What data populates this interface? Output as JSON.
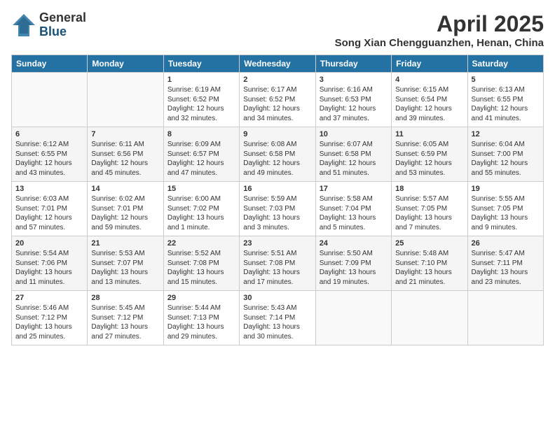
{
  "logo": {
    "general": "General",
    "blue": "Blue"
  },
  "title": {
    "month_year": "April 2025",
    "location": "Song Xian Chengguanzhen, Henan, China"
  },
  "headers": [
    "Sunday",
    "Monday",
    "Tuesday",
    "Wednesday",
    "Thursday",
    "Friday",
    "Saturday"
  ],
  "weeks": [
    [
      {
        "day": "",
        "info": ""
      },
      {
        "day": "",
        "info": ""
      },
      {
        "day": "1",
        "info": "Sunrise: 6:19 AM\nSunset: 6:52 PM\nDaylight: 12 hours\nand 32 minutes."
      },
      {
        "day": "2",
        "info": "Sunrise: 6:17 AM\nSunset: 6:52 PM\nDaylight: 12 hours\nand 34 minutes."
      },
      {
        "day": "3",
        "info": "Sunrise: 6:16 AM\nSunset: 6:53 PM\nDaylight: 12 hours\nand 37 minutes."
      },
      {
        "day": "4",
        "info": "Sunrise: 6:15 AM\nSunset: 6:54 PM\nDaylight: 12 hours\nand 39 minutes."
      },
      {
        "day": "5",
        "info": "Sunrise: 6:13 AM\nSunset: 6:55 PM\nDaylight: 12 hours\nand 41 minutes."
      }
    ],
    [
      {
        "day": "6",
        "info": "Sunrise: 6:12 AM\nSunset: 6:55 PM\nDaylight: 12 hours\nand 43 minutes."
      },
      {
        "day": "7",
        "info": "Sunrise: 6:11 AM\nSunset: 6:56 PM\nDaylight: 12 hours\nand 45 minutes."
      },
      {
        "day": "8",
        "info": "Sunrise: 6:09 AM\nSunset: 6:57 PM\nDaylight: 12 hours\nand 47 minutes."
      },
      {
        "day": "9",
        "info": "Sunrise: 6:08 AM\nSunset: 6:58 PM\nDaylight: 12 hours\nand 49 minutes."
      },
      {
        "day": "10",
        "info": "Sunrise: 6:07 AM\nSunset: 6:58 PM\nDaylight: 12 hours\nand 51 minutes."
      },
      {
        "day": "11",
        "info": "Sunrise: 6:05 AM\nSunset: 6:59 PM\nDaylight: 12 hours\nand 53 minutes."
      },
      {
        "day": "12",
        "info": "Sunrise: 6:04 AM\nSunset: 7:00 PM\nDaylight: 12 hours\nand 55 minutes."
      }
    ],
    [
      {
        "day": "13",
        "info": "Sunrise: 6:03 AM\nSunset: 7:01 PM\nDaylight: 12 hours\nand 57 minutes."
      },
      {
        "day": "14",
        "info": "Sunrise: 6:02 AM\nSunset: 7:01 PM\nDaylight: 12 hours\nand 59 minutes."
      },
      {
        "day": "15",
        "info": "Sunrise: 6:00 AM\nSunset: 7:02 PM\nDaylight: 13 hours\nand 1 minute."
      },
      {
        "day": "16",
        "info": "Sunrise: 5:59 AM\nSunset: 7:03 PM\nDaylight: 13 hours\nand 3 minutes."
      },
      {
        "day": "17",
        "info": "Sunrise: 5:58 AM\nSunset: 7:04 PM\nDaylight: 13 hours\nand 5 minutes."
      },
      {
        "day": "18",
        "info": "Sunrise: 5:57 AM\nSunset: 7:05 PM\nDaylight: 13 hours\nand 7 minutes."
      },
      {
        "day": "19",
        "info": "Sunrise: 5:55 AM\nSunset: 7:05 PM\nDaylight: 13 hours\nand 9 minutes."
      }
    ],
    [
      {
        "day": "20",
        "info": "Sunrise: 5:54 AM\nSunset: 7:06 PM\nDaylight: 13 hours\nand 11 minutes."
      },
      {
        "day": "21",
        "info": "Sunrise: 5:53 AM\nSunset: 7:07 PM\nDaylight: 13 hours\nand 13 minutes."
      },
      {
        "day": "22",
        "info": "Sunrise: 5:52 AM\nSunset: 7:08 PM\nDaylight: 13 hours\nand 15 minutes."
      },
      {
        "day": "23",
        "info": "Sunrise: 5:51 AM\nSunset: 7:08 PM\nDaylight: 13 hours\nand 17 minutes."
      },
      {
        "day": "24",
        "info": "Sunrise: 5:50 AM\nSunset: 7:09 PM\nDaylight: 13 hours\nand 19 minutes."
      },
      {
        "day": "25",
        "info": "Sunrise: 5:48 AM\nSunset: 7:10 PM\nDaylight: 13 hours\nand 21 minutes."
      },
      {
        "day": "26",
        "info": "Sunrise: 5:47 AM\nSunset: 7:11 PM\nDaylight: 13 hours\nand 23 minutes."
      }
    ],
    [
      {
        "day": "27",
        "info": "Sunrise: 5:46 AM\nSunset: 7:12 PM\nDaylight: 13 hours\nand 25 minutes."
      },
      {
        "day": "28",
        "info": "Sunrise: 5:45 AM\nSunset: 7:12 PM\nDaylight: 13 hours\nand 27 minutes."
      },
      {
        "day": "29",
        "info": "Sunrise: 5:44 AM\nSunset: 7:13 PM\nDaylight: 13 hours\nand 29 minutes."
      },
      {
        "day": "30",
        "info": "Sunrise: 5:43 AM\nSunset: 7:14 PM\nDaylight: 13 hours\nand 30 minutes."
      },
      {
        "day": "",
        "info": ""
      },
      {
        "day": "",
        "info": ""
      },
      {
        "day": "",
        "info": ""
      }
    ]
  ]
}
